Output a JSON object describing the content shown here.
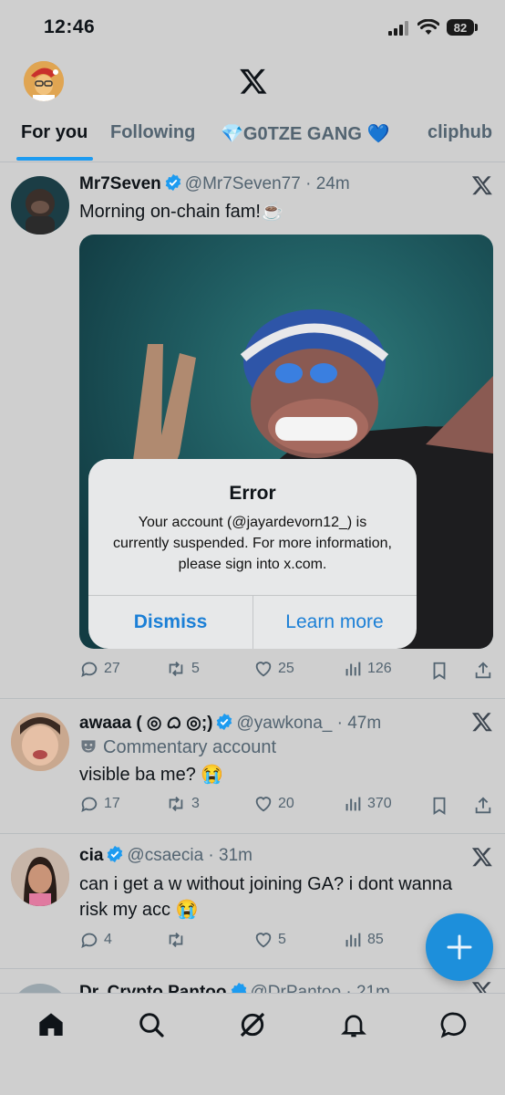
{
  "status_bar": {
    "time": "12:46",
    "battery": "82"
  },
  "tabs": [
    "For you",
    "Following",
    "💎G0TZE GANG 💙",
    "cliphub"
  ],
  "tweets": [
    {
      "name": "Mr7Seven",
      "handle": "@Mr7Seven77",
      "time": "24m",
      "text": "Morning on-chain fam!☕",
      "stats": {
        "replies": "27",
        "reposts": "5",
        "likes": "25",
        "views": "126"
      }
    },
    {
      "name": "awaaa ( ◎ ᜊ ◎;)",
      "handle": "@yawkona_",
      "time": "47m",
      "label": "Commentary account",
      "text": "visible ba me? 😭",
      "stats": {
        "replies": "17",
        "reposts": "3",
        "likes": "20",
        "views": "370"
      }
    },
    {
      "name": "cia",
      "handle": "@csaecia",
      "time": "31m",
      "text": "can i get a w without joining GA? i dont wanna risk my acc 😭",
      "stats": {
        "replies": "4",
        "reposts": "",
        "likes": "5",
        "views": "85"
      }
    },
    {
      "name": "Dr. Crypto Pantoo",
      "handle": "@DrPantoo",
      "time": "21m"
    }
  ],
  "dialog": {
    "title": "Error",
    "message": "Your account (@jayardevorn12_) is currently suspended. For more information, please sign into x.com.",
    "dismiss": "Dismiss",
    "learn_more": "Learn more"
  },
  "fab": {
    "label": "+"
  },
  "colors": {
    "accent": "#1d9bf0",
    "dialog_button": "#1b7fd6",
    "background": "#cfcfcf"
  }
}
